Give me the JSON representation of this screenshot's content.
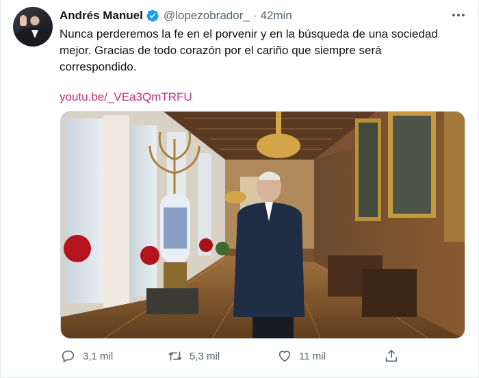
{
  "author": {
    "name": "Andrés Manuel",
    "handle": "@lopezobrador_",
    "separator": "·",
    "time": "42min",
    "verified": true
  },
  "tweet": {
    "text_line1": "Nunca perderemos la fe en el porvenir y en la búsqueda de una sociedad",
    "text_line2": "mejor. Gracias de todo corazón por el cariño que siempre será",
    "text_line3": "correspondido.",
    "link": "youtu.be/_VEa3QmTRFU"
  },
  "actions": {
    "replies": "3,1 mil",
    "retweets": "5,3 mil",
    "likes": "11 mil"
  },
  "icons": {
    "verified": "verified-badge-icon",
    "more": "more-options-icon",
    "reply": "reply-icon",
    "retweet": "retweet-icon",
    "like": "heart-icon",
    "share": "share-icon"
  },
  "colors": {
    "link": "#c4307a",
    "verified": "#1d9bf0",
    "muted": "#536471"
  }
}
